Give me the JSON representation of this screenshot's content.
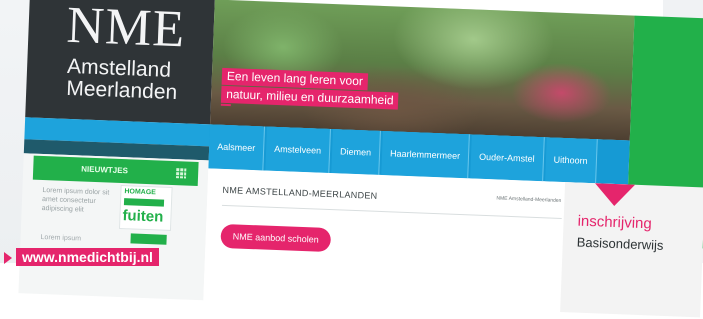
{
  "brand": {
    "logo_title": "NME",
    "logo_line1": "Amstelland",
    "logo_line2": "Meerlanden"
  },
  "hero": {
    "tagline_lines": [
      "Een leven lang leren voor",
      "natuur, milieu en duurzaamheid"
    ]
  },
  "nav": {
    "items": [
      "Aalsmeer",
      "Amstelveen",
      "Diemen",
      "Haarlemmermeer",
      "Ouder-Amstel",
      "Uithoorn"
    ]
  },
  "news": {
    "header": "NIEUWTJES",
    "item1_text": "Lorem ipsum dolor sit amet consectetur adipiscing elit",
    "thumb_top": "HOMAGE",
    "thumb_big": "fuiten",
    "item2_text": "Lorem ipsum"
  },
  "main": {
    "title": "NME AMSTELLAND-MEERLANDEN",
    "breadcrumb": "NME Amstelland-Meerlanden",
    "button_label": "NME aanbod scholen"
  },
  "sidebar_right": {
    "inschrijving": "inschrijving",
    "basisonderwijs": "Basisonderwijs"
  },
  "overlay": {
    "url": "www.nmedichtbij.nl"
  },
  "colors": {
    "accent_pink": "#e5256c",
    "accent_green": "#22b04a",
    "accent_blue": "#1ea3dc",
    "dark_panel": "#2f3437"
  }
}
